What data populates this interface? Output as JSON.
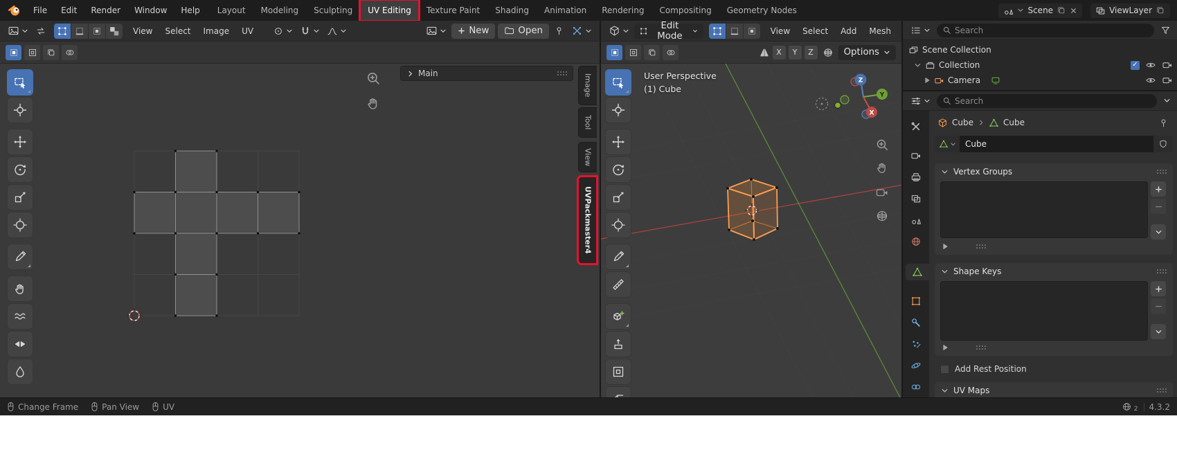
{
  "topbar": {
    "menus": [
      {
        "label": "File"
      },
      {
        "label": "Edit"
      },
      {
        "label": "Render"
      },
      {
        "label": "Window"
      },
      {
        "label": "Help"
      }
    ],
    "workspaces": [
      {
        "label": "Layout"
      },
      {
        "label": "Modeling"
      },
      {
        "label": "Sculpting"
      },
      {
        "label": "UV Editing"
      },
      {
        "label": "Texture Paint"
      },
      {
        "label": "Shading"
      },
      {
        "label": "Animation"
      },
      {
        "label": "Rendering"
      },
      {
        "label": "Compositing"
      },
      {
        "label": "Geometry Nodes"
      }
    ],
    "active_workspace": "UV Editing",
    "scene_selector": {
      "label": "Scene"
    },
    "viewlayer_selector": {
      "label": "ViewLayer"
    }
  },
  "uv_editor": {
    "menus": [
      {
        "label": "View"
      },
      {
        "label": "Select"
      },
      {
        "label": "Image"
      },
      {
        "label": "UV"
      }
    ],
    "new_button": "New",
    "open_button": "Open",
    "region_label": "Main",
    "sidebar_tabs": [
      {
        "label": "Image"
      },
      {
        "label": "Tool"
      },
      {
        "label": "View"
      },
      {
        "label": "UVPackmaster4"
      }
    ],
    "highlighted_tab": "UVPackmaster4",
    "tools": [
      {
        "name": "Select Box"
      },
      {
        "name": "2D Cursor"
      },
      {
        "name": "Move"
      },
      {
        "name": "Rotate"
      },
      {
        "name": "Scale"
      },
      {
        "name": "Transform"
      },
      {
        "name": "Annotate"
      },
      {
        "name": "Grab"
      },
      {
        "name": "Relax"
      },
      {
        "name": "Pinch"
      },
      {
        "name": "Smear"
      }
    ]
  },
  "viewport": {
    "mode": "Edit Mode",
    "menus": [
      {
        "label": "View"
      },
      {
        "label": "Select"
      },
      {
        "label": "Add"
      },
      {
        "label": "Mesh"
      }
    ],
    "mirror_axes": [
      {
        "label": "X"
      },
      {
        "label": "Y"
      },
      {
        "label": "Z"
      }
    ],
    "options_button": "Options",
    "overlay": {
      "line1": "User Perspective",
      "line2": "(1) Cube"
    },
    "gizmo_axes": [
      {
        "label": "Z"
      },
      {
        "label": "Y"
      },
      {
        "label": "X"
      }
    ],
    "tools": [
      {
        "name": "Select Box"
      },
      {
        "name": "Cursor"
      },
      {
        "name": "Move"
      },
      {
        "name": "Rotate"
      },
      {
        "name": "Scale"
      },
      {
        "name": "Transform"
      },
      {
        "name": "Annotate"
      },
      {
        "name": "Measure"
      },
      {
        "name": "Add Cube"
      },
      {
        "name": "Extrude Region"
      },
      {
        "name": "Inset Faces"
      },
      {
        "name": "Bevel"
      }
    ]
  },
  "outliner": {
    "search_placeholder": "Search",
    "rows": [
      {
        "label": "Scene Collection"
      },
      {
        "label": "Collection"
      },
      {
        "label": "Camera"
      }
    ]
  },
  "properties": {
    "search_placeholder": "Search",
    "breadcrumb": {
      "object": "Cube",
      "data": "Cube"
    },
    "mesh_name": "Cube",
    "tabs": [
      {
        "name": "Tool"
      },
      {
        "name": "Render"
      },
      {
        "name": "Output"
      },
      {
        "name": "View Layer"
      },
      {
        "name": "Scene"
      },
      {
        "name": "World"
      },
      {
        "name": "Object Data",
        "active": true
      },
      {
        "name": "Object"
      },
      {
        "name": "Modifiers"
      },
      {
        "name": "Particles"
      },
      {
        "name": "Physics"
      },
      {
        "name": "Constraints"
      }
    ],
    "panels": {
      "vertex_groups": "Vertex Groups",
      "shape_keys": "Shape Keys",
      "add_rest_position": "Add Rest Position",
      "uv_maps": "UV Maps"
    }
  },
  "statusbar": {
    "hints": [
      {
        "label": "Change Frame"
      },
      {
        "label": "Pan View"
      },
      {
        "label": "UV"
      }
    ],
    "network_badge": "2",
    "version": "4.3.2"
  },
  "annotations": {
    "highlight_color": "#e8112d",
    "highlighted": [
      "UV Editing",
      "UVPackmaster4"
    ]
  },
  "icons": {
    "search": "magnifier svg",
    "zoom_in": "magnifier with plus",
    "pan": "hand",
    "camera": "camera body with lens cone",
    "eye": "visibility eye",
    "mesh_data": "green triangle with vertex dots",
    "object": "orange cube outline",
    "chevron_down": "small v chevron",
    "grip": "drag dot grid",
    "mouse": "mouse outline with button divider"
  }
}
